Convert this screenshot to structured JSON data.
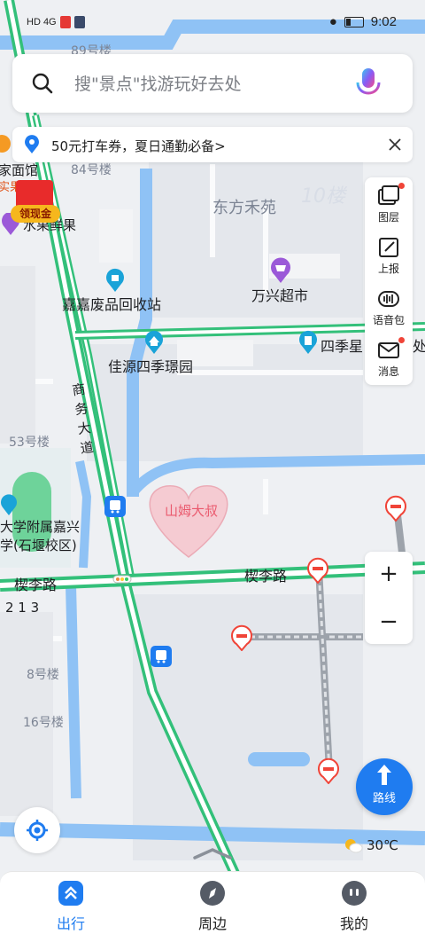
{
  "status_bar": {
    "signal": "HD 4G",
    "time": "9:02"
  },
  "search": {
    "placeholder": "搜\"景点\"找游玩好去处"
  },
  "notice": {
    "text": "50元打车券，夏日通勤必备>"
  },
  "tools": [
    {
      "label": "图层",
      "icon": "layers-icon"
    },
    {
      "label": "上报",
      "icon": "report-edit-icon"
    },
    {
      "label": "语音包",
      "icon": "voice-pack-icon"
    },
    {
      "label": "消息",
      "icon": "message-icon"
    }
  ],
  "coupon": {
    "label": "领现金"
  },
  "map_labels": {
    "building_89": "89号楼",
    "building_84": "84号楼",
    "noodle": "家面馆",
    "fruit_shop": "水果鲜果",
    "fruit_prefix": "实果",
    "dongfang": "东方禾苑",
    "wanxing": "万兴超市",
    "recycle": "嘉嘉废品回收站",
    "jiayuan": "佳源四季璟园",
    "siji": "四季星",
    "siji_suffix": "处",
    "shangwu": "商务大道",
    "building_53": "53号楼",
    "school_1": "大学附属嘉兴",
    "school_2": "学(石堰校区)",
    "road": "楔李路",
    "road_left": "楔李路",
    "num_213": "2 1 3",
    "building_8": "8号楼",
    "building_16": "16号楼",
    "heart": "山姆大叔",
    "watermark": "10楼"
  },
  "zoom": {
    "in": "+",
    "out": "−"
  },
  "route": {
    "label": "路线"
  },
  "weather": {
    "temp": "30℃",
    "icon": "partly-sunny-icon"
  },
  "nav": [
    {
      "label": "出行",
      "active": true,
      "icon": "travel-icon"
    },
    {
      "label": "周边",
      "active": false,
      "icon": "compass-icon"
    },
    {
      "label": "我的",
      "active": false,
      "icon": "profile-icon"
    }
  ],
  "colors": {
    "accent": "#1f7cf0",
    "road_green": "#33c07a",
    "water": "#8fc2f5",
    "block_bg": "#e2e6ec",
    "alert_red": "#f04438"
  }
}
